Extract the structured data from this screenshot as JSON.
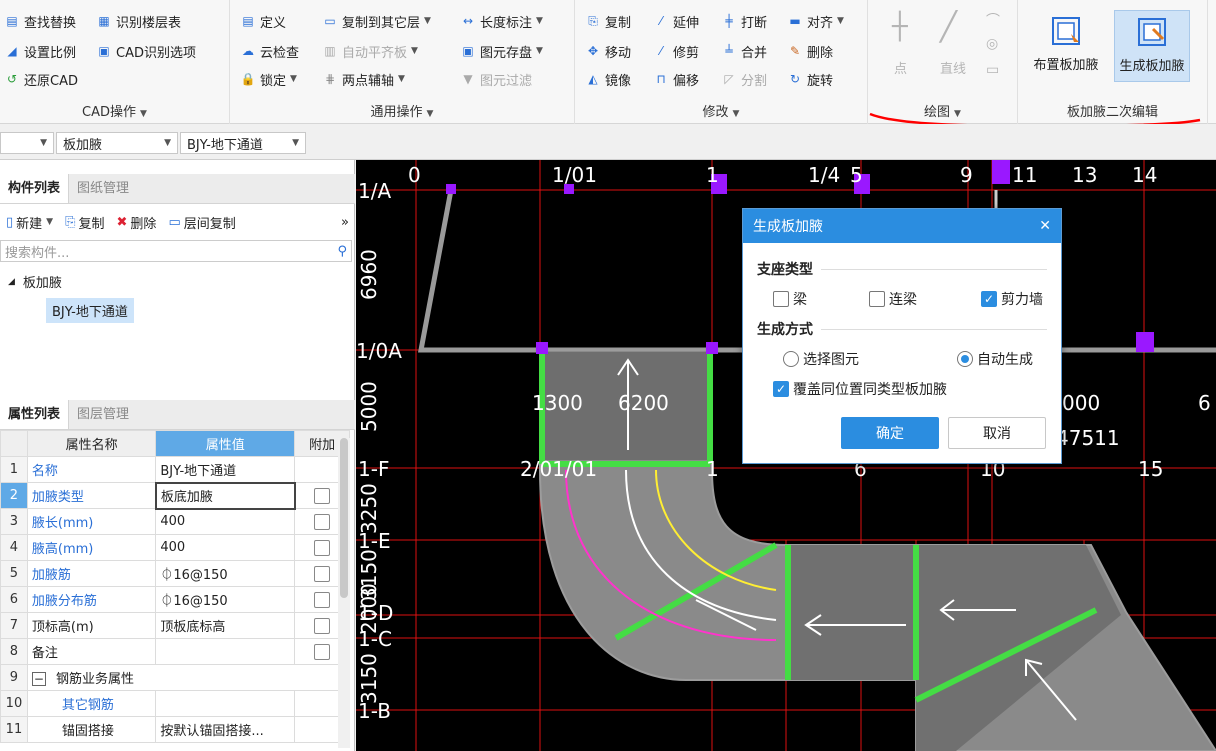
{
  "ribbon": {
    "cad_ops": {
      "label": "CAD操作",
      "items": [
        "查找替换",
        "识别楼层表",
        "设置比例",
        "CAD识别选项",
        "还原CAD"
      ]
    },
    "general_ops": {
      "label": "通用操作",
      "items": [
        "定义",
        "复制到其它层",
        "长度标注",
        "云检查",
        "自动平齐板",
        "图元存盘",
        "锁定",
        "两点辅轴",
        "图元过滤"
      ]
    },
    "modify": {
      "label": "修改",
      "items": [
        "复制",
        "延伸",
        "打断",
        "对齐",
        "移动",
        "修剪",
        "合并",
        "删除",
        "镜像",
        "偏移",
        "分割",
        "旋转"
      ]
    },
    "draw": {
      "label": "绘图",
      "point": "点",
      "line": "直线"
    },
    "slab_haunch": {
      "label": "板加腋二次编辑",
      "place": "布置板加腋",
      "generate": "生成板加腋"
    }
  },
  "selectors": {
    "type": "板加腋",
    "instance": "BJY-地下通道"
  },
  "left": {
    "tabs1": [
      "构件列表",
      "图纸管理"
    ],
    "toolbar": {
      "new": "新建",
      "copy": "复制",
      "delete": "删除",
      "layer_copy": "层间复制",
      "more": "»"
    },
    "search_placeholder": "搜索构件...",
    "tree_root": "板加腋",
    "tree_child": "BJY-地下通道",
    "tabs2": [
      "属性列表",
      "图层管理"
    ],
    "table_headers": {
      "name": "属性名称",
      "value": "属性值",
      "extra": "附加"
    },
    "rows": [
      {
        "n": "1",
        "name": "名称",
        "value": "BJY-地下通道"
      },
      {
        "n": "2",
        "name": "加腋类型",
        "value": "板底加腋"
      },
      {
        "n": "3",
        "name": "腋长(mm)",
        "value": "400"
      },
      {
        "n": "4",
        "name": "腋高(mm)",
        "value": "400"
      },
      {
        "n": "5",
        "name": "加腋筋",
        "value": "⏀16@150"
      },
      {
        "n": "6",
        "name": "加腋分布筋",
        "value": "⏀16@150"
      },
      {
        "n": "7",
        "name": "顶标高(m)",
        "value": "顶板底标高"
      },
      {
        "n": "8",
        "name": "备注",
        "value": ""
      },
      {
        "n": "9",
        "name": "钢筋业务属性",
        "value": ""
      },
      {
        "n": "10",
        "name": "其它钢筋",
        "value": ""
      },
      {
        "n": "11",
        "name": "锚固搭接",
        "value": "按默认锚固搭接..."
      }
    ],
    "group_toggle": "−"
  },
  "canvas": {
    "top_axis": [
      "0",
      "1/01",
      "1",
      "1/4",
      "5",
      "9",
      "11",
      "13",
      "14"
    ],
    "mid_axis": [
      "2/01/01",
      "1",
      "6",
      "10",
      "15"
    ],
    "left_axis": [
      "1/A",
      "1/0A",
      "1-F",
      "1-E",
      "1-D",
      "1-C",
      "1-B"
    ],
    "dims": [
      "6960",
      "5000",
      "3250",
      "3150",
      "2000",
      "3150"
    ],
    "span_texts": [
      "1300",
      "6200",
      "000",
      "6",
      "47511"
    ]
  },
  "dialog": {
    "title": "生成板加腋",
    "close": "✕",
    "support_label": "支座类型",
    "beam": "梁",
    "link_beam": "连梁",
    "shear_wall": "剪力墙",
    "gen_label": "生成方式",
    "select": "选择图元",
    "auto": "自动生成",
    "cover": "覆盖同位置同类型板加腋",
    "ok": "确定",
    "cancel": "取消"
  },
  "colors": {
    "accent": "#2b8de0",
    "annotation": "#ff0000"
  }
}
